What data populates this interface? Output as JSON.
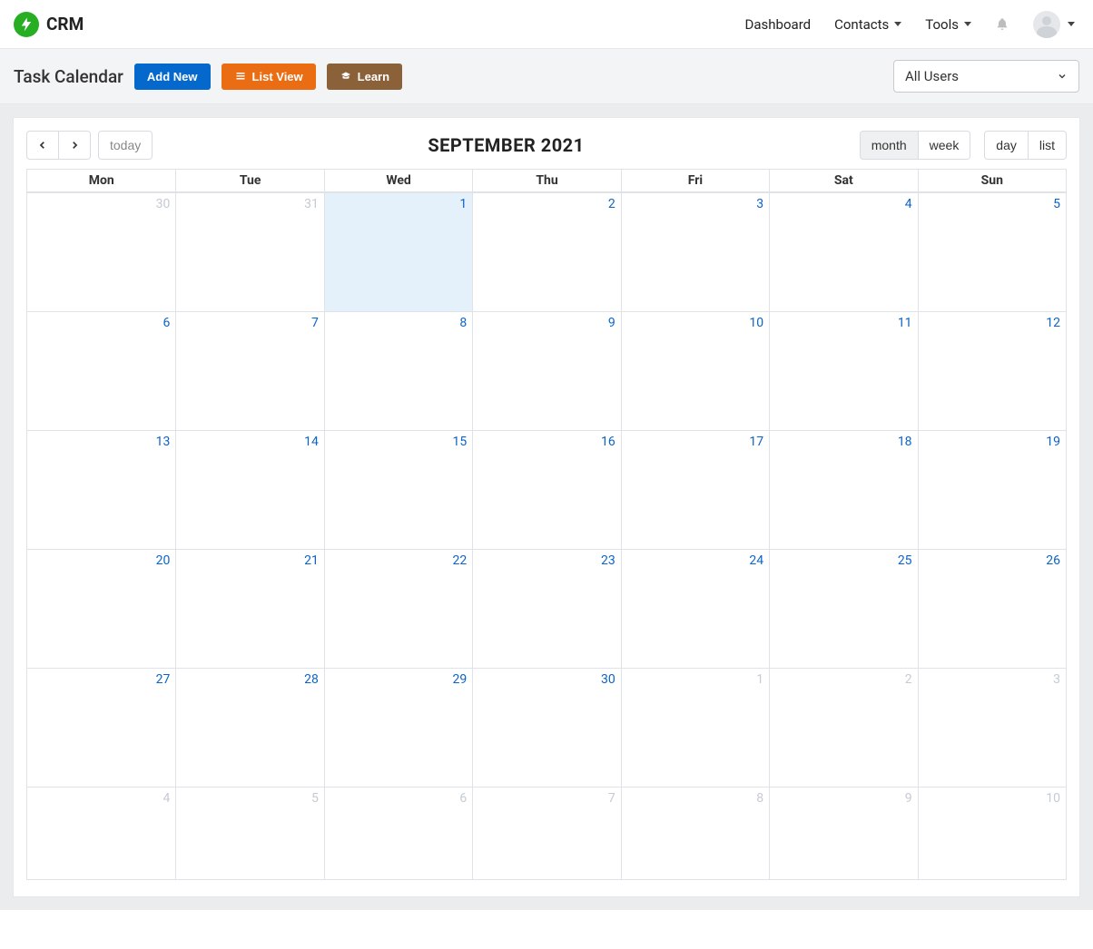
{
  "brand": {
    "name": "CRM"
  },
  "nav": {
    "dashboard": "Dashboard",
    "contacts": "Contacts",
    "tools": "Tools"
  },
  "subbar": {
    "title": "Task Calendar",
    "add_new": "Add New",
    "list_view": "List View",
    "learn": "Learn",
    "user_filter": "All Users"
  },
  "toolbar": {
    "today": "today",
    "views": {
      "month": "month",
      "week": "week",
      "day": "day",
      "list": "list"
    },
    "active_view": "month"
  },
  "calendar": {
    "title": "SEPTEMBER 2021",
    "day_headers": [
      "Mon",
      "Tue",
      "Wed",
      "Thu",
      "Fri",
      "Sat",
      "Sun"
    ],
    "weeks": [
      [
        {
          "n": "30",
          "other": true
        },
        {
          "n": "31",
          "other": true
        },
        {
          "n": "1",
          "today": true
        },
        {
          "n": "2"
        },
        {
          "n": "3"
        },
        {
          "n": "4"
        },
        {
          "n": "5"
        }
      ],
      [
        {
          "n": "6"
        },
        {
          "n": "7"
        },
        {
          "n": "8"
        },
        {
          "n": "9"
        },
        {
          "n": "10"
        },
        {
          "n": "11"
        },
        {
          "n": "12"
        }
      ],
      [
        {
          "n": "13"
        },
        {
          "n": "14"
        },
        {
          "n": "15"
        },
        {
          "n": "16"
        },
        {
          "n": "17"
        },
        {
          "n": "18"
        },
        {
          "n": "19"
        }
      ],
      [
        {
          "n": "20"
        },
        {
          "n": "21"
        },
        {
          "n": "22"
        },
        {
          "n": "23"
        },
        {
          "n": "24"
        },
        {
          "n": "25"
        },
        {
          "n": "26"
        }
      ],
      [
        {
          "n": "27"
        },
        {
          "n": "28"
        },
        {
          "n": "29"
        },
        {
          "n": "30"
        },
        {
          "n": "1",
          "other": true
        },
        {
          "n": "2",
          "other": true
        },
        {
          "n": "3",
          "other": true
        }
      ],
      [
        {
          "n": "4",
          "other": true
        },
        {
          "n": "5",
          "other": true
        },
        {
          "n": "6",
          "other": true
        },
        {
          "n": "7",
          "other": true
        },
        {
          "n": "8",
          "other": true
        },
        {
          "n": "9",
          "other": true
        },
        {
          "n": "10",
          "other": true
        }
      ]
    ]
  }
}
